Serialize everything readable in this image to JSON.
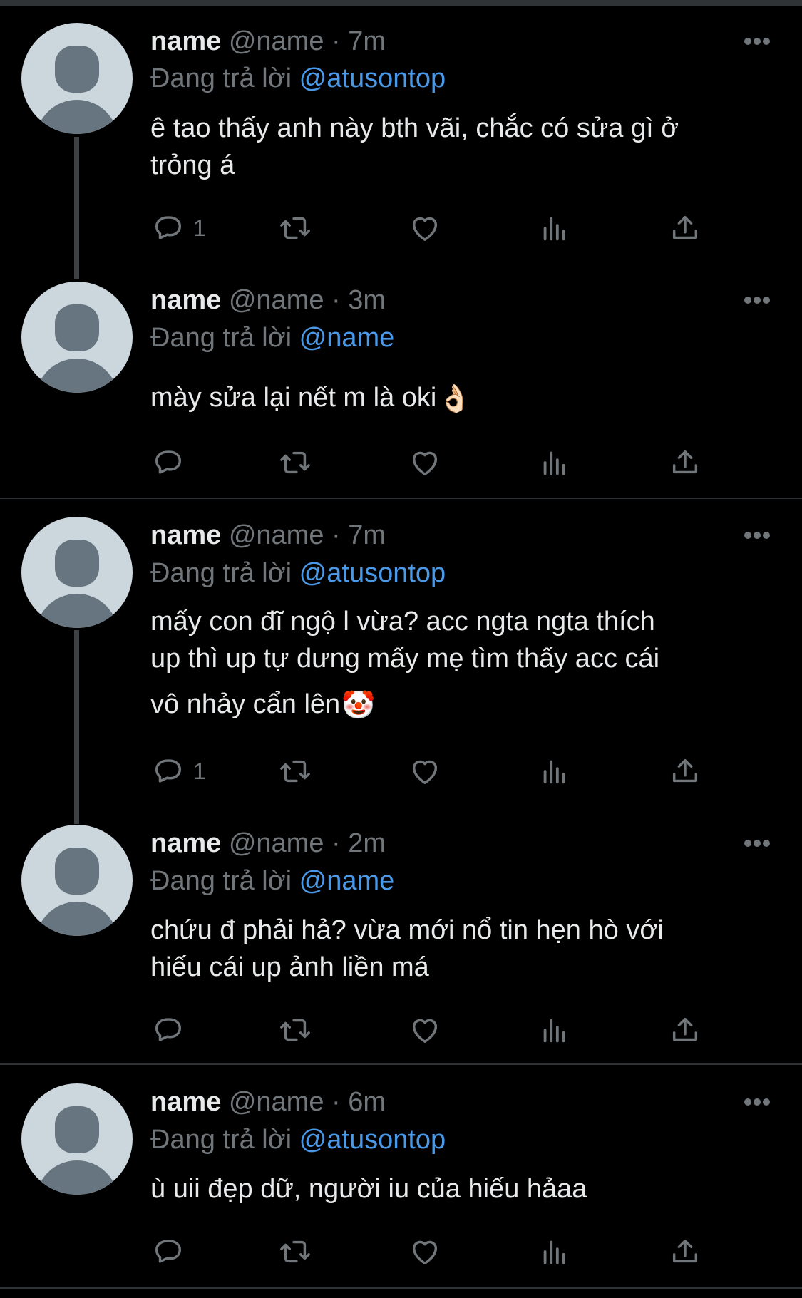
{
  "reply_prefix": "Đang trả lời",
  "tweets": [
    {
      "name": "name",
      "meta": "@name · 7m",
      "reply_to": "@atusontop",
      "text": [
        "ê tao thấy anh này bth vãi, chắc có sửa gì ở",
        "trỏng á"
      ],
      "emoji": "",
      "reply_count": "1"
    },
    {
      "name": "name",
      "meta": "@name · 3m",
      "reply_to": "@name",
      "text": [
        "mày sửa lại nết m là oki"
      ],
      "emoji": "👌🏻",
      "reply_count": ""
    },
    {
      "name": "name",
      "meta": "@name · 7m",
      "reply_to": "@atusontop",
      "text": [
        "mấy con đĩ ngộ l vừa? acc ngta ngta thích",
        "up thì up tự dưng mấy mẹ tìm thấy acc cái",
        "vô nhảy cẩn lên"
      ],
      "emoji": "🤡",
      "reply_count": "1"
    },
    {
      "name": "name",
      "meta": "@name · 2m",
      "reply_to": "@name",
      "text": [
        "chứu đ phải hả? vừa mới nổ tin hẹn hò với",
        "hiếu cái up ảnh liền má"
      ],
      "emoji": "",
      "reply_count": ""
    },
    {
      "name": "name",
      "meta": "@name · 6m",
      "reply_to": "@atusontop",
      "text": [
        "ù uii đẹp dữ, người iu của hiếu hảaa"
      ],
      "emoji": "",
      "reply_count": ""
    }
  ],
  "icons": [
    "reply-icon",
    "retweet-icon",
    "like-icon",
    "views-icon",
    "share-icon",
    "more-icon"
  ],
  "colors": {
    "background": "#000000",
    "text": "#e7e9ea",
    "muted": "#71767b",
    "link": "#4a99e9",
    "divider": "#2f3336"
  }
}
